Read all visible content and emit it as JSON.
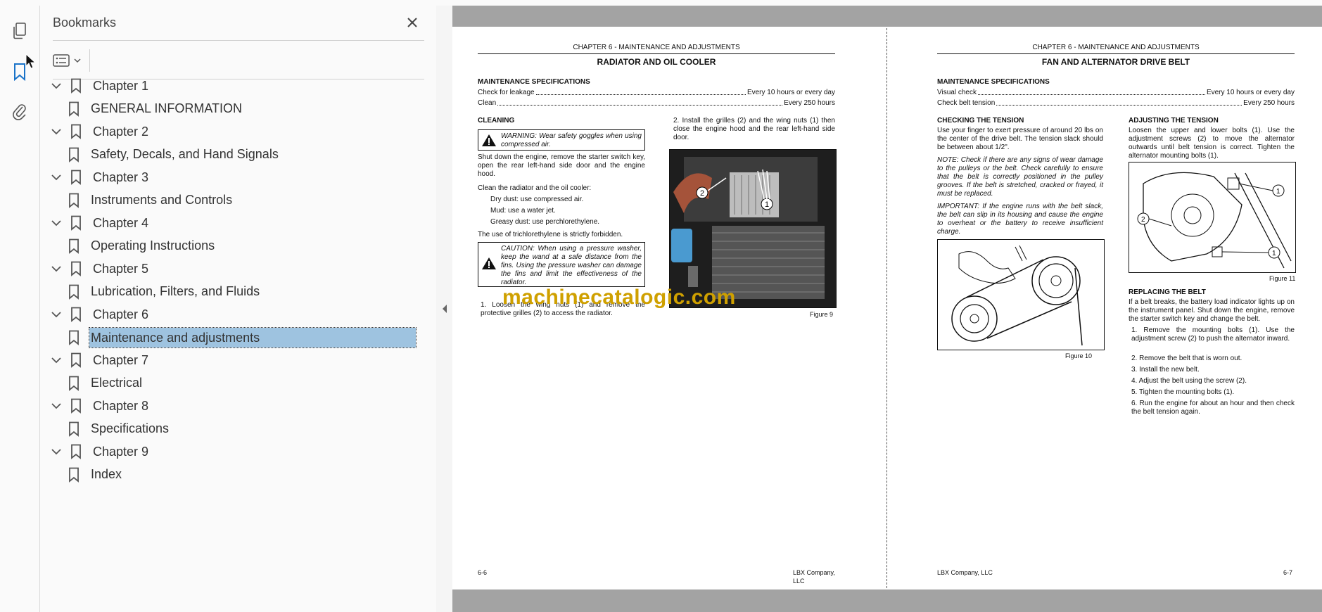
{
  "panel": {
    "title": "Bookmarks",
    "close_icon": "close-icon",
    "options_icon": "list-options-icon"
  },
  "rail": {
    "icons": [
      "page-thumbnails-icon",
      "bookmark-icon",
      "attachment-icon"
    ]
  },
  "bookmarks": [
    {
      "label": "Chapter 1",
      "level": 0
    },
    {
      "label": "GENERAL INFORMATION",
      "level": 1
    },
    {
      "label": "Chapter 2",
      "level": 0
    },
    {
      "label": "Safety, Decals, and Hand Signals",
      "level": 1
    },
    {
      "label": "Chapter 3",
      "level": 0
    },
    {
      "label": "Instruments and Controls",
      "level": 1
    },
    {
      "label": "Chapter 4",
      "level": 0
    },
    {
      "label": "Operating Instructions",
      "level": 1
    },
    {
      "label": "Chapter 5",
      "level": 0
    },
    {
      "label": "Lubrication, Filters, and Fluids",
      "level": 1
    },
    {
      "label": "Chapter 6",
      "level": 0
    },
    {
      "label": "Maintenance and adjustments",
      "level": 1,
      "selected": true
    },
    {
      "label": "Chapter 7",
      "level": 0
    },
    {
      "label": "Electrical",
      "level": 1
    },
    {
      "label": "Chapter 8",
      "level": 0
    },
    {
      "label": "Specifications",
      "level": 1
    },
    {
      "label": "Chapter 9",
      "level": 0
    },
    {
      "label": "Index",
      "level": 1
    }
  ],
  "left_page": {
    "header": "CHAPTER 6 - MAINTENANCE AND ADJUSTMENTS",
    "title": "RADIATOR AND OIL COOLER",
    "spec_heading": "MAINTENANCE SPECIFICATIONS",
    "specs": [
      {
        "item": "Check for leakage",
        "value": "Every 10 hours or every day"
      },
      {
        "item": "Clean",
        "value": "Every 250 hours"
      }
    ],
    "cleaning_heading": "CLEANING",
    "warning": "WARNING: Wear safety goggles when using compressed air.",
    "para1": "Shut down the engine, remove the starter switch key, open the rear left-hand side door and the engine hood.",
    "para2": "Clean the radiator and the oil cooler:",
    "list": [
      "Dry dust: use compressed air.",
      "Mud: use a water jet.",
      "Greasy dust: use perchlorethylene."
    ],
    "para3": "The use of trichlorethylene is strictly forbidden.",
    "caution": "CAUTION: When using a pressure washer, keep the wand at a safe distance from the fins. Using the pressure washer can damage the fins and limit the effectiveness of the radiator.",
    "step1": "1. Loosen the wing nuts (1) and remove the protective grilles (2) to access the radiator.",
    "step2": "2. Install the grilles (2) and the wing nuts (1) then close the engine hood and the rear left-hand side door.",
    "figure": "Figure 9",
    "footer_left": "6-6",
    "footer_right": "LBX Company, LLC"
  },
  "right_page": {
    "header": "CHAPTER 6 - MAINTENANCE AND ADJUSTMENTS",
    "title": "FAN AND ALTERNATOR DRIVE BELT",
    "spec_heading": "MAINTENANCE SPECIFICATIONS",
    "specs": [
      {
        "item": "Visual check",
        "value": "Every 10 hours or every day"
      },
      {
        "item": "Check belt tension",
        "value": "Every 250 hours"
      }
    ],
    "checking_heading": "CHECKING THE TENSION",
    "checking_text": "Use your finger to exert pressure of around 20 lbs on the center of the drive belt. The tension slack should be between about 1/2\".",
    "note": "NOTE: Check if there are any signs of wear damage to the pulleys or the belt. Check carefully to ensure that the belt is correctly positioned in the pulley grooves. If the belt is stretched, cracked or frayed, it must be replaced.",
    "important": "IMPORTANT: If the engine runs with the belt slack, the belt can slip in its housing and cause the engine to overheat or the battery to receive insufficient charge.",
    "figure10": "Figure 10",
    "adjusting_heading": "ADJUSTING THE TENSION",
    "adjusting_text": "Loosen the upper and lower bolts (1). Use the adjustment screws (2) to move the alternator outwards until belt tension is correct. Tighten the alternator mounting bolts (1).",
    "figure11": "Figure 11",
    "replacing_heading": "REPLACING THE BELT",
    "replacing_text": "If a belt breaks, the battery load indicator lights up on the instrument panel. Shut down the engine, remove the starter switch key and change the belt.",
    "steps": [
      "1. Remove the mounting bolts (1). Use the adjustment screw (2) to push the alternator inward.",
      "2. Remove the belt that is worn out.",
      "3. Install the new belt.",
      "4. Adjust the belt using the screw (2).",
      "5. Tighten the mounting bolts (1).",
      "6. Run the engine for about an hour and then check the belt tension again."
    ],
    "footer_left": "LBX Company, LLC",
    "footer_right": "6-7"
  },
  "watermark": "machinecatalogic.com",
  "colors": {
    "selection": "#9ec3e0",
    "accent": "#1a73c8",
    "gutter": "#a3a3a3",
    "watermark": "#cfa000"
  }
}
